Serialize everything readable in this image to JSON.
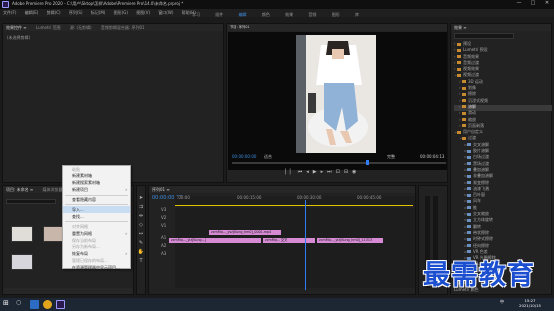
{
  "titlebar": {
    "title": "Adobe Premiere Pro 2020 - C:\\用户\\Sktop\\怎样\\Adobe\\Premiere Pro\\14.0\\未命名.prproj *",
    "minimize": "—",
    "maximize": "□",
    "close": "✕"
  },
  "menubar": [
    "文件(F)",
    "编辑(E)",
    "剪辑(C)",
    "序列(S)",
    "标记(M)",
    "图形(G)",
    "视图(V)",
    "窗口(W)",
    "帮助(H)"
  ],
  "workspaces": [
    "学习",
    "组件",
    "编辑",
    "颜色",
    "效果",
    "音频",
    "图形",
    "库"
  ],
  "source_panel": {
    "tabs": [
      "效果控件 ≡",
      "Lumetri 范围",
      "源: (无剪辑)",
      "音频剪辑混合器: 序列01"
    ],
    "placeholder": "(未选择剪辑)"
  },
  "program_monitor": {
    "tab": "节目: 序列01",
    "timecode_left": "00:00:00:00",
    "fit": "适合",
    "quality": "完整",
    "timecode_right": "00:00:04:13"
  },
  "effects_panel": {
    "tab": "效果 ≡",
    "search_placeholder": "",
    "items": [
      {
        "label": "预设",
        "level": 0,
        "open": false
      },
      {
        "label": "Lumetri 预设",
        "level": 0,
        "open": false
      },
      {
        "label": "音频效果",
        "level": 0,
        "open": false
      },
      {
        "label": "音频过渡",
        "level": 0,
        "open": false
      },
      {
        "label": "视频效果",
        "level": 0,
        "open": false
      },
      {
        "label": "视频过渡",
        "level": 0,
        "open": true
      },
      {
        "label": "3D 运动",
        "level": 1,
        "open": false
      },
      {
        "label": "划像",
        "level": 1,
        "open": false
      },
      {
        "label": "擦除",
        "level": 1,
        "open": false
      },
      {
        "label": "沉浸式视频",
        "level": 1,
        "open": false
      },
      {
        "label": "溶解",
        "level": 1,
        "open": false
      },
      {
        "label": "滑动",
        "level": 1,
        "open": false
      },
      {
        "label": "缩放",
        "level": 1,
        "open": false
      },
      {
        "label": "页面剥落",
        "level": 1,
        "open": false
      },
      {
        "label": "用户自定义",
        "level": 0,
        "open": true
      },
      {
        "label": "过渡",
        "level": 1,
        "open": true
      },
      {
        "label": "交叉溶解",
        "level": 2,
        "open": false
      },
      {
        "label": "胶片溶解",
        "level": 2,
        "open": false
      },
      {
        "label": "白场过渡",
        "level": 2,
        "open": false
      },
      {
        "label": "黑场过渡",
        "level": 2,
        "open": false
      },
      {
        "label": "叠加溶解",
        "level": 2,
        "open": false
      },
      {
        "label": "非叠加溶解",
        "level": 2,
        "open": false
      },
      {
        "label": "渐变擦除",
        "level": 2,
        "open": false
      },
      {
        "label": "油漆飞溅",
        "level": 2,
        "open": false
      },
      {
        "label": "百叶窗",
        "level": 2,
        "open": false
      },
      {
        "label": "风车",
        "level": 2,
        "open": false
      },
      {
        "label": "推",
        "level": 2,
        "open": false
      },
      {
        "label": "交叉缩放",
        "level": 2,
        "open": false
      },
      {
        "label": "立方体旋转",
        "level": 2,
        "open": false
      },
      {
        "label": "翻转",
        "level": 2,
        "open": false
      },
      {
        "label": "带状擦除",
        "level": 2,
        "open": false
      },
      {
        "label": "时钟式擦除",
        "level": 2,
        "open": false
      },
      {
        "label": "径向擦除",
        "level": 2,
        "open": false
      },
      {
        "label": "VR 色差",
        "level": 2,
        "open": false
      },
      {
        "label": "VR 光圈擦除",
        "level": 2,
        "open": false
      },
      {
        "label": "VR 光线",
        "level": 2,
        "open": false
      }
    ],
    "bottom_panels": [
      "基本图形",
      "基本声音",
      "Lumetri 颜色",
      "库",
      "标记",
      "历史记录",
      "信息"
    ]
  },
  "project_panel": {
    "tabs": [
      "项目: 未命名 ≡",
      "媒体浏览器",
      "库"
    ],
    "search_placeholder": ""
  },
  "context_menu": {
    "items": [
      {
        "label": "粘贴",
        "disabled": true
      },
      {
        "label": "新建素材箱",
        "disabled": false
      },
      {
        "label": "新建搜索素材箱",
        "disabled": false
      },
      {
        "label": "新建项目",
        "disabled": false,
        "submenu": true
      },
      {
        "sep": true
      },
      {
        "label": "查看隐藏内容",
        "disabled": false
      },
      {
        "sep": true
      },
      {
        "label": "导入...",
        "disabled": false,
        "highlight": true
      },
      {
        "label": "查找...",
        "disabled": false
      },
      {
        "sep": true
      },
      {
        "label": "对齐网格",
        "disabled": true
      },
      {
        "label": "重置为网格",
        "disabled": false,
        "submenu": true
      },
      {
        "label": "保存当前布局",
        "disabled": true
      },
      {
        "label": "另存为新布局...",
        "disabled": true
      },
      {
        "label": "恢复布局",
        "disabled": false,
        "submenu": true
      },
      {
        "label": "管理已保存的布局...",
        "disabled": true
      },
      {
        "label": "在资源管理器中显示项目...",
        "disabled": false
      }
    ]
  },
  "timeline": {
    "tab": "序列01 ≡",
    "timecode": "00:00:00:00",
    "ruler": [
      ":00:00",
      "00:00:15:00",
      "00:00:30:00",
      "00:00:45:00"
    ],
    "tracks": [
      "V3",
      "V2",
      "V1",
      "A1",
      "A2",
      "A3"
    ],
    "clips_v1": [
      {
        "label": "zcmMq..._yiz[Kung...]",
        "color": "#d58ad3"
      },
      {
        "label": "zcmMq... 交叉",
        "color": "#d58ad3"
      },
      {
        "label": "zcmMq..._yiz[Kung_hm0]_11313",
        "color": "#d58ad3"
      }
    ],
    "clips_v2": [
      {
        "label": "zcmMq..._ysz[Kung_hm0]_0001.mp4",
        "color": "#d58ad3"
      }
    ]
  },
  "taskbar": {
    "time": "15:27",
    "date": "2021/10/15",
    "lang": "中"
  },
  "watermark": "最需教育",
  "colors": {
    "accent": "#3d8fe0",
    "clip": "#d58ad3",
    "playhead": "#2f7cf6",
    "menu_highlight": "#c8dcf2"
  }
}
